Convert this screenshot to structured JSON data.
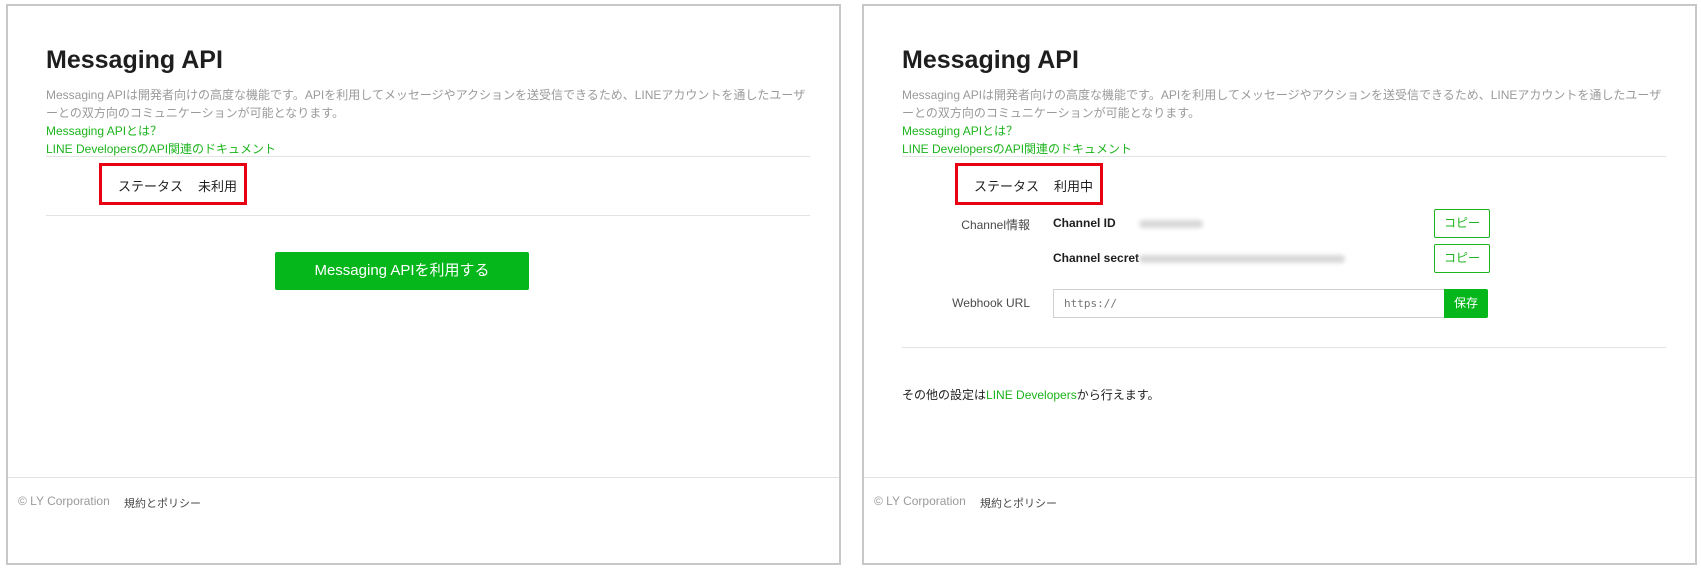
{
  "colors": {
    "accent": "#06b71c",
    "link": "#1db41d",
    "highlight": "#e60012"
  },
  "left": {
    "title": "Messaging API",
    "description": "Messaging APIは開発者向けの高度な機能です。APIを利用してメッセージやアクションを送受信できるため、LINEアカウントを通したユーザーとの双方向のコミュニケーションが可能となります。",
    "link_about": "Messaging APIとは？",
    "link_docs": "LINE DevelopersのAPI関連のドキュメント",
    "status_label": "ステータス",
    "status_value": "未利用",
    "cta_label": "Messaging APIを利用する",
    "footer_copyright": "© LY Corporation",
    "footer_policy": "規約とポリシー"
  },
  "right": {
    "title": "Messaging API",
    "description": "Messaging APIは開発者向けの高度な機能です。APIを利用してメッセージやアクションを送受信できるため、LINEアカウントを通したユーザーとの双方向のコミュニケーションが可能となります。",
    "link_about": "Messaging APIとは？",
    "link_docs": "LINE DevelopersのAPI関連のドキュメント",
    "status_label": "ステータス",
    "status_value": "利用中",
    "channel_info_label": "Channel情報",
    "channel_id_label": "Channel ID",
    "channel_secret_label": "Channel secret",
    "copy_label": "コピー",
    "webhook_label": "Webhook URL",
    "webhook_placeholder": "https://",
    "save_label": "保存",
    "other_prefix": "その他の設定は",
    "other_link": "LINE Developers",
    "other_suffix": "から行えます。",
    "footer_copyright": "© LY Corporation",
    "footer_policy": "規約とポリシー"
  }
}
